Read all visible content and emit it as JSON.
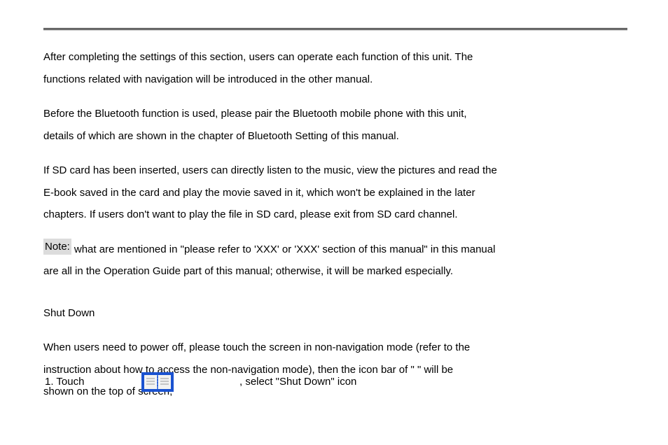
{
  "title_missing": "",
  "body": {
    "p1": "After completing the settings of this section, users can operate each function of this unit. The",
    "p2": "functions related with navigation will be introduced in the other manual.",
    "p3": "Before the Bluetooth function is used, please pair the Bluetooth mobile phone with this unit,",
    "p4": "details of which are shown in the chapter of Bluetooth Setting of this manual.",
    "p5": "If SD card has been inserted, users can directly listen to the music, view the pictures and read the",
    "p6": "E-book saved in the card and play the movie saved in it, which won't be explained in the later",
    "p7": "chapters. If users don't want to play the file in SD card, please exit from SD card channel.",
    "note_label": "Note:",
    "note_text": "what are mentioned in \"please refer to 'XXX' or 'XXX' section of this manual\" in this manual",
    "note_line2": "are all in the Operation Guide part of this manual; otherwise, it will be marked especially.",
    "h_shutdown": "Shut Down",
    "sd1": "When users need to power off, please touch the screen in non-navigation mode (refer to the",
    "sd2": "instruction about how to access the non-navigation mode), then the icon bar of \"    \" will be",
    "sd3": "shown on the top of screen;",
    "step_num": "1.  Touch",
    "step_text": ", select \"Shut Down\" icon"
  },
  "icon_name": "book-icon"
}
